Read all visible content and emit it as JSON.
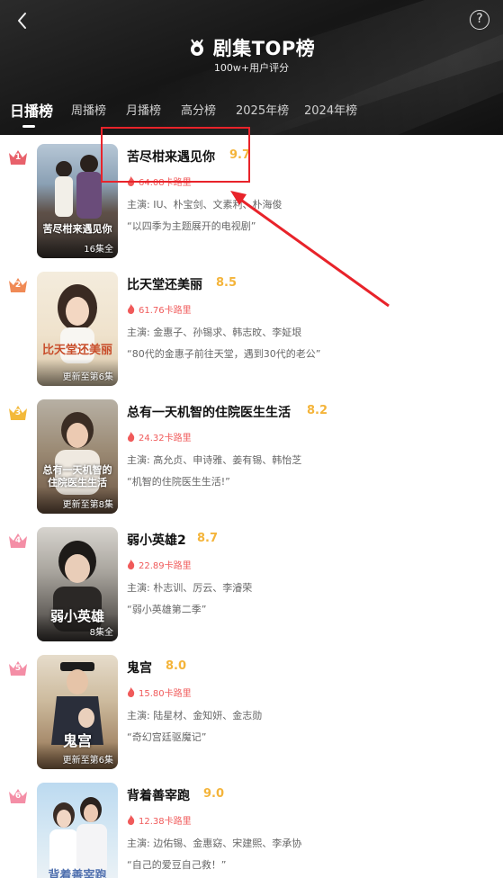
{
  "header": {
    "title": "剧集TOP榜",
    "subtitle": "100w+用户评分",
    "back_icon": "chevron-left-icon",
    "help_icon": "question-circle-icon",
    "help_label": "?"
  },
  "tabs": [
    {
      "label": "日播榜",
      "active": true
    },
    {
      "label": "周播榜",
      "active": false
    },
    {
      "label": "月播榜",
      "active": false
    },
    {
      "label": "高分榜",
      "active": false
    },
    {
      "label": "2025年榜",
      "active": false
    },
    {
      "label": "2024年榜",
      "active": false
    }
  ],
  "items": [
    {
      "rank": "1",
      "title": "苦尽柑来遇见你",
      "score": "9.7",
      "heat": "64.08卡路里",
      "cast": "主演: IU、朴宝剑、文素利、朴海俊",
      "quote": "“以四季为主题展开的电视剧”",
      "poster_text": "苦尽柑来遇见你",
      "episodes": "16集全",
      "crown_color": "#e8616b"
    },
    {
      "rank": "2",
      "title": "比天堂还美丽",
      "score": "8.5",
      "heat": "61.76卡路里",
      "cast": "主演: 金惠子、孙锡求、韩志旼、李姃垠",
      "quote": "“80代的金惠子前往天堂，遇到30代的老公”",
      "poster_text": "比天堂还美丽",
      "episodes": "更新至第6集",
      "crown_color": "#f08a55"
    },
    {
      "rank": "3",
      "title": "总有一天机智的住院医生生活",
      "score": "8.2",
      "heat": "24.32卡路里",
      "cast": "主演: 高允贞、申诗雅、姜有锡、韩怡芝",
      "quote": "“机智的住院医生生活!”",
      "poster_text": "总有一天机智的住院医生生活",
      "episodes": "更新至第8集",
      "crown_color": "#f3b93a"
    },
    {
      "rank": "4",
      "title": "弱小英雄2",
      "score": "8.7",
      "heat": "22.89卡路里",
      "cast": "主演: 朴志训、厉云、李濬荣",
      "quote": "“弱小英雄第二季”",
      "poster_text": "弱小英雄",
      "episodes": "8集全",
      "crown_color": "#f48ea6"
    },
    {
      "rank": "5",
      "title": "鬼宫",
      "score": "8.0",
      "heat": "15.80卡路里",
      "cast": "主演: 陆星材、金知妍、金志勋",
      "quote": "“奇幻宫廷驱魔记”",
      "poster_text": "鬼宫",
      "episodes": "更新至第6集",
      "crown_color": "#f48ea6"
    },
    {
      "rank": "6",
      "title": "背着善宰跑",
      "score": "9.0",
      "heat": "12.38卡路里",
      "cast": "主演: 边佑锡、金惠窈、宋建熙、李承协",
      "quote": "“自己的爱豆自己救！”",
      "poster_text": "背着善宰跑",
      "episodes": "",
      "crown_color": "#f48ea6"
    }
  ]
}
